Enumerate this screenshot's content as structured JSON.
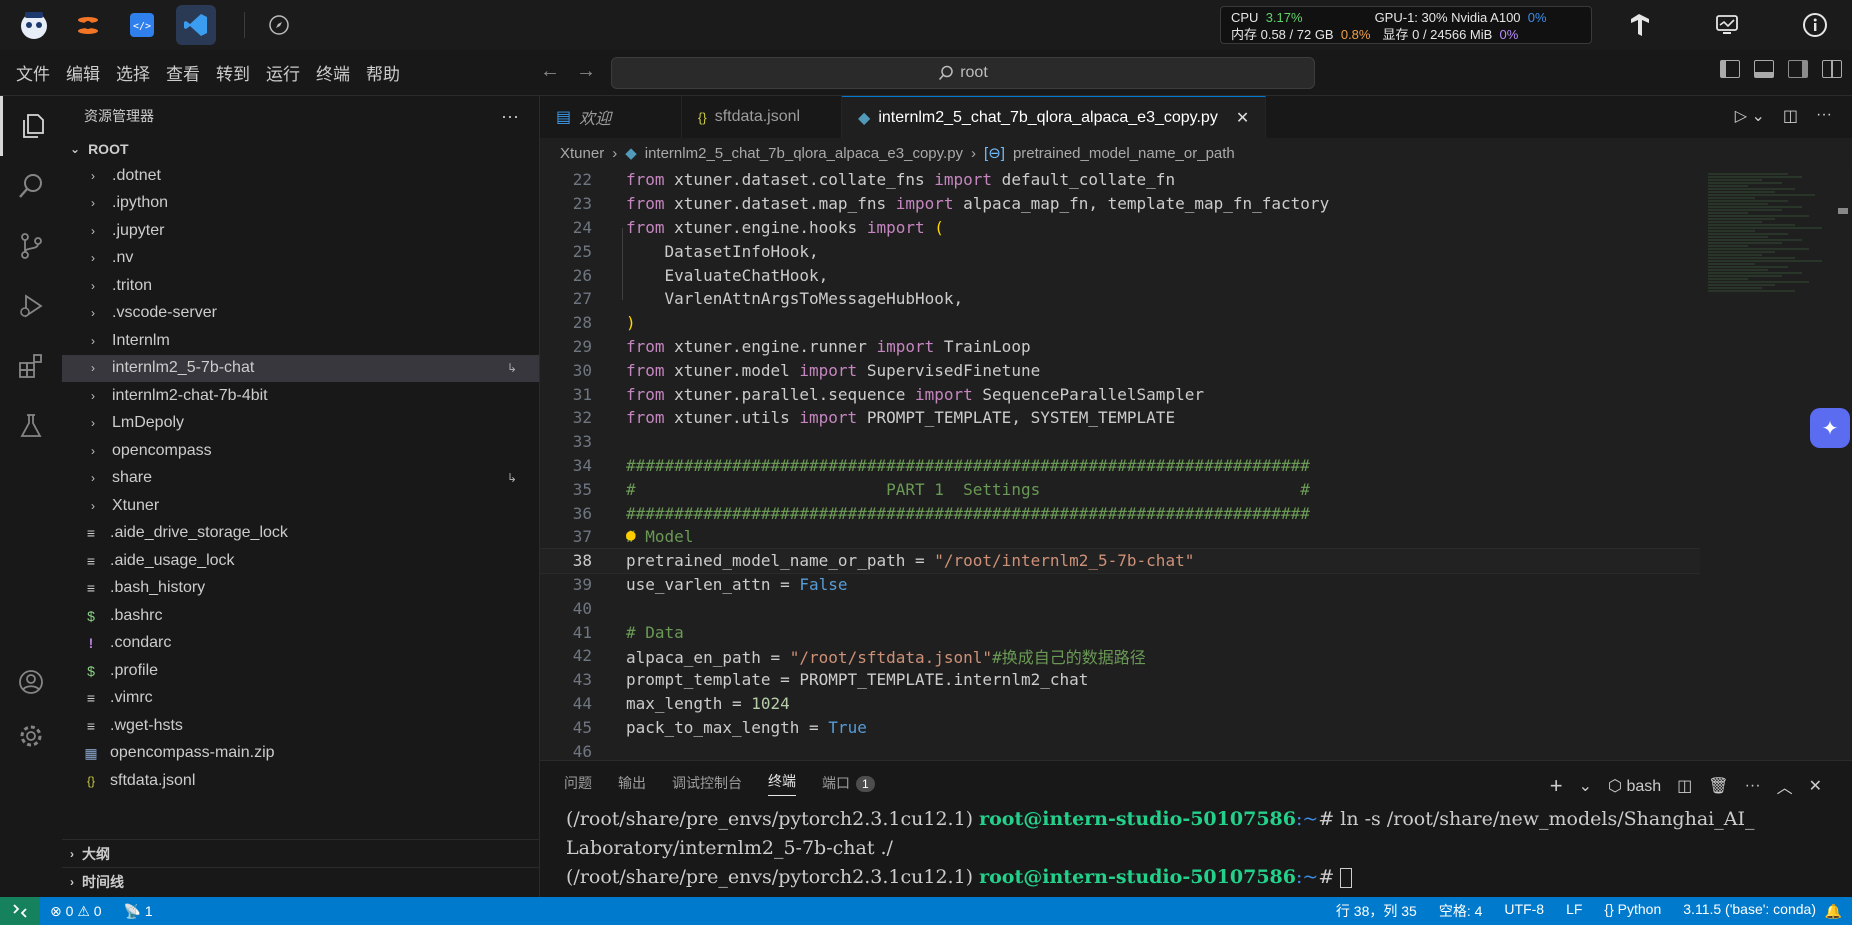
{
  "topbar": {
    "cpu_label": "CPU",
    "cpu_value": "3.17%",
    "gpu_label": "GPU-1: 30% Nvidia A100",
    "gpu_value": "0%",
    "mem_label": "内存 0.58 / 72 GB",
    "mem_value": "0.8%",
    "vram_label": "显存 0 / 24566 MiB",
    "vram_value": "0%"
  },
  "menu": [
    "文件",
    "编辑",
    "选择",
    "查看",
    "转到",
    "运行",
    "终端",
    "帮助"
  ],
  "search": {
    "text": "root"
  },
  "sidebar": {
    "title": "资源管理器",
    "more": "···",
    "root": "ROOT",
    "folders": [
      ".dotnet",
      ".ipython",
      ".jupyter",
      ".nv",
      ".triton",
      ".vscode-server",
      "Internlm",
      "internlm2_5-7b-chat",
      "internlm2-chat-7b-4bit",
      "LmDepoly",
      "opencompass",
      "share",
      "Xtuner"
    ],
    "files": [
      {
        "name": ".aide_drive_storage_lock",
        "icon": "≡"
      },
      {
        "name": ".aide_usage_lock",
        "icon": "≡"
      },
      {
        "name": ".bash_history",
        "icon": "≡"
      },
      {
        "name": ".bashrc",
        "icon": "$"
      },
      {
        "name": ".condarc",
        "icon": "!"
      },
      {
        "name": ".profile",
        "icon": "$"
      },
      {
        "name": ".vimrc",
        "icon": "≡"
      },
      {
        "name": ".wget-hsts",
        "icon": "≡"
      },
      {
        "name": "opencompass-main.zip",
        "icon": "▦"
      },
      {
        "name": "sftdata.jsonl",
        "icon": "{}"
      }
    ],
    "outline": "大纲",
    "timeline": "时间线"
  },
  "tabs": [
    {
      "label": "欢迎"
    },
    {
      "label": "sftdata.jsonl"
    },
    {
      "label": "internlm2_5_chat_7b_qlora_alpaca_e3_copy.py"
    }
  ],
  "breadcrumb": [
    "Xtuner",
    "internlm2_5_chat_7b_qlora_alpaca_e3_copy.py",
    "pretrained_model_name_or_path"
  ],
  "code_lines": [
    22,
    23,
    24,
    25,
    26,
    27,
    28,
    29,
    30,
    31,
    32,
    33,
    34,
    35,
    36,
    37,
    38,
    39,
    40,
    41,
    42,
    43,
    44,
    45,
    46
  ],
  "code": {
    "l22a": "from",
    "l22b": " xtuner.dataset.collate_fns ",
    "l22c": "import",
    "l22d": " default_collate_fn",
    "l23a": "from",
    "l23b": " xtuner.dataset.map_fns ",
    "l23c": "import",
    "l23d": " alpaca_map_fn, template_map_fn_factory",
    "l24a": "from",
    "l24b": " xtuner.engine.hooks ",
    "l24c": "import",
    "l24d": " (",
    "l25": "    DatasetInfoHook,",
    "l26": "    EvaluateChatHook,",
    "l27": "    VarlenAttnArgsToMessageHubHook,",
    "l28": ")",
    "l29a": "from",
    "l29b": " xtuner.engine.runner ",
    "l29c": "import",
    "l29d": " TrainLoop",
    "l30a": "from",
    "l30b": " xtuner.model ",
    "l30c": "import",
    "l30d": " SupervisedFinetune",
    "l31a": "from",
    "l31b": " xtuner.parallel.sequence ",
    "l31c": "import",
    "l31d": " SequenceParallelSampler",
    "l32a": "from",
    "l32b": " xtuner.utils ",
    "l32c": "import",
    "l32d": " PROMPT_TEMPLATE, SYSTEM_TEMPLATE",
    "l34": "#######################################################################",
    "l35": "#                          PART 1  Settings                           #",
    "l36": "#######################################################################",
    "l37": "# Model",
    "l38a": "pretrained_model_name_or_path = ",
    "l38b": "\"/root/internlm2_5-7b-chat\"",
    "l39a": "use_varlen_attn = ",
    "l39b": "False",
    "l41": "# Data",
    "l42a": "alpaca_en_path = ",
    "l42b": "\"/root/sftdata.jsonl\"",
    "l42c": "#换成自己的数据路径",
    "l43": "prompt_template = PROMPT_TEMPLATE.internlm2_chat",
    "l44a": "max_length = ",
    "l44b": "1024",
    "l45a": "pack_to_max_length = ",
    "l45b": "True"
  },
  "panel": {
    "tabs": [
      "问题",
      "输出",
      "调试控制台",
      "终端",
      "端口"
    ],
    "ports_count": "1",
    "shell": "bash",
    "line1_env": "(/root/share/pre_envs/pytorch2.3.1cu12.1) ",
    "line1_user": "root@intern-studio-50107586",
    "line1_path": ":~",
    "line1_cmd": "# ln -s /root/share/new_models/Shanghai_AI_",
    "line2": "Laboratory/internlm2_5-7b-chat ./",
    "line3_env": "(/root/share/pre_envs/pytorch2.3.1cu12.1) ",
    "line3_user": "root@intern-studio-50107586",
    "line3_path": ":~",
    "line3_cmd": "# "
  },
  "status": {
    "errors": "0",
    "warnings": "0",
    "ports": "1",
    "position": "行 38，列 35",
    "spaces": "空格: 4",
    "encoding": "UTF-8",
    "eol": "LF",
    "language": "Python",
    "interpreter": "3.11.5 ('base': conda)"
  },
  "colors": {
    "accent": "#007acc",
    "remote": "#16825d"
  }
}
